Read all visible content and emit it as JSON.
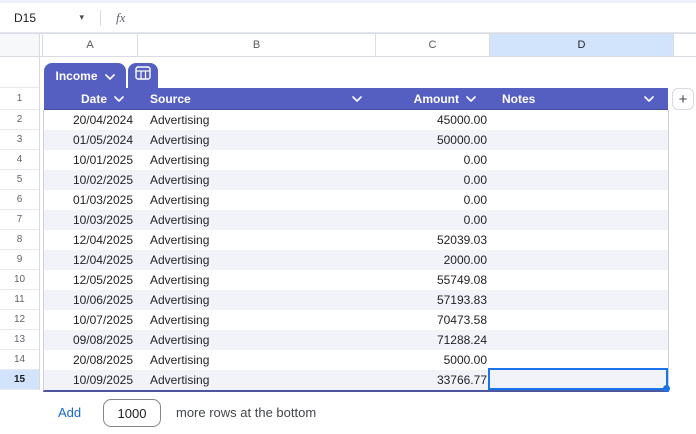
{
  "topbar": {
    "name_box_value": "D15",
    "formula_label": "fx"
  },
  "column_strip": {
    "letters": [
      "A",
      "B",
      "C",
      "D"
    ],
    "selected_letter": "D"
  },
  "sheet_table_tab": {
    "label": "Income"
  },
  "table": {
    "headers": [
      {
        "label": "Date"
      },
      {
        "label": "Source"
      },
      {
        "label": "Amount"
      },
      {
        "label": "Notes"
      }
    ],
    "rows": [
      {
        "num": 2,
        "date": "20/04/2024",
        "source": "Advertising",
        "amount": "45000.00",
        "notes": ""
      },
      {
        "num": 3,
        "date": "01/05/2024",
        "source": "Advertising",
        "amount": "50000.00",
        "notes": ""
      },
      {
        "num": 4,
        "date": "10/01/2025",
        "source": "Advertising",
        "amount": "0.00",
        "notes": ""
      },
      {
        "num": 5,
        "date": "10/02/2025",
        "source": "Advertising",
        "amount": "0.00",
        "notes": ""
      },
      {
        "num": 6,
        "date": "01/03/2025",
        "source": "Advertising",
        "amount": "0.00",
        "notes": ""
      },
      {
        "num": 7,
        "date": "10/03/2025",
        "source": "Advertising",
        "amount": "0.00",
        "notes": ""
      },
      {
        "num": 8,
        "date": "12/04/2025",
        "source": "Advertising",
        "amount": "52039.03",
        "notes": ""
      },
      {
        "num": 9,
        "date": "12/04/2025",
        "source": "Advertising",
        "amount": "2000.00",
        "notes": ""
      },
      {
        "num": 10,
        "date": "12/05/2025",
        "source": "Advertising",
        "amount": "55749.08",
        "notes": ""
      },
      {
        "num": 11,
        "date": "10/06/2025",
        "source": "Advertising",
        "amount": "57193.83",
        "notes": ""
      },
      {
        "num": 12,
        "date": "10/07/2025",
        "source": "Advertising",
        "amount": "70473.58",
        "notes": ""
      },
      {
        "num": 13,
        "date": "09/08/2025",
        "source": "Advertising",
        "amount": "71288.24",
        "notes": ""
      },
      {
        "num": 14,
        "date": "20/08/2025",
        "source": "Advertising",
        "amount": "5000.00",
        "notes": ""
      },
      {
        "num": 15,
        "date": "10/09/2025",
        "source": "Advertising",
        "amount": "33766.77",
        "notes": ""
      }
    ],
    "add_column_label": "+",
    "header_row_number": "1"
  },
  "selection": {
    "cell_ref": "D15",
    "row": 15,
    "column": "D"
  },
  "footer": {
    "add_label": "Add",
    "rows_count": "1000",
    "suffix_text": "more rows at the bottom"
  },
  "colors": {
    "table_accent": "#555FC2",
    "selection": "#1A73E8",
    "selected_header_bg": "#D2E3FC",
    "band": "#F1F3F9"
  }
}
